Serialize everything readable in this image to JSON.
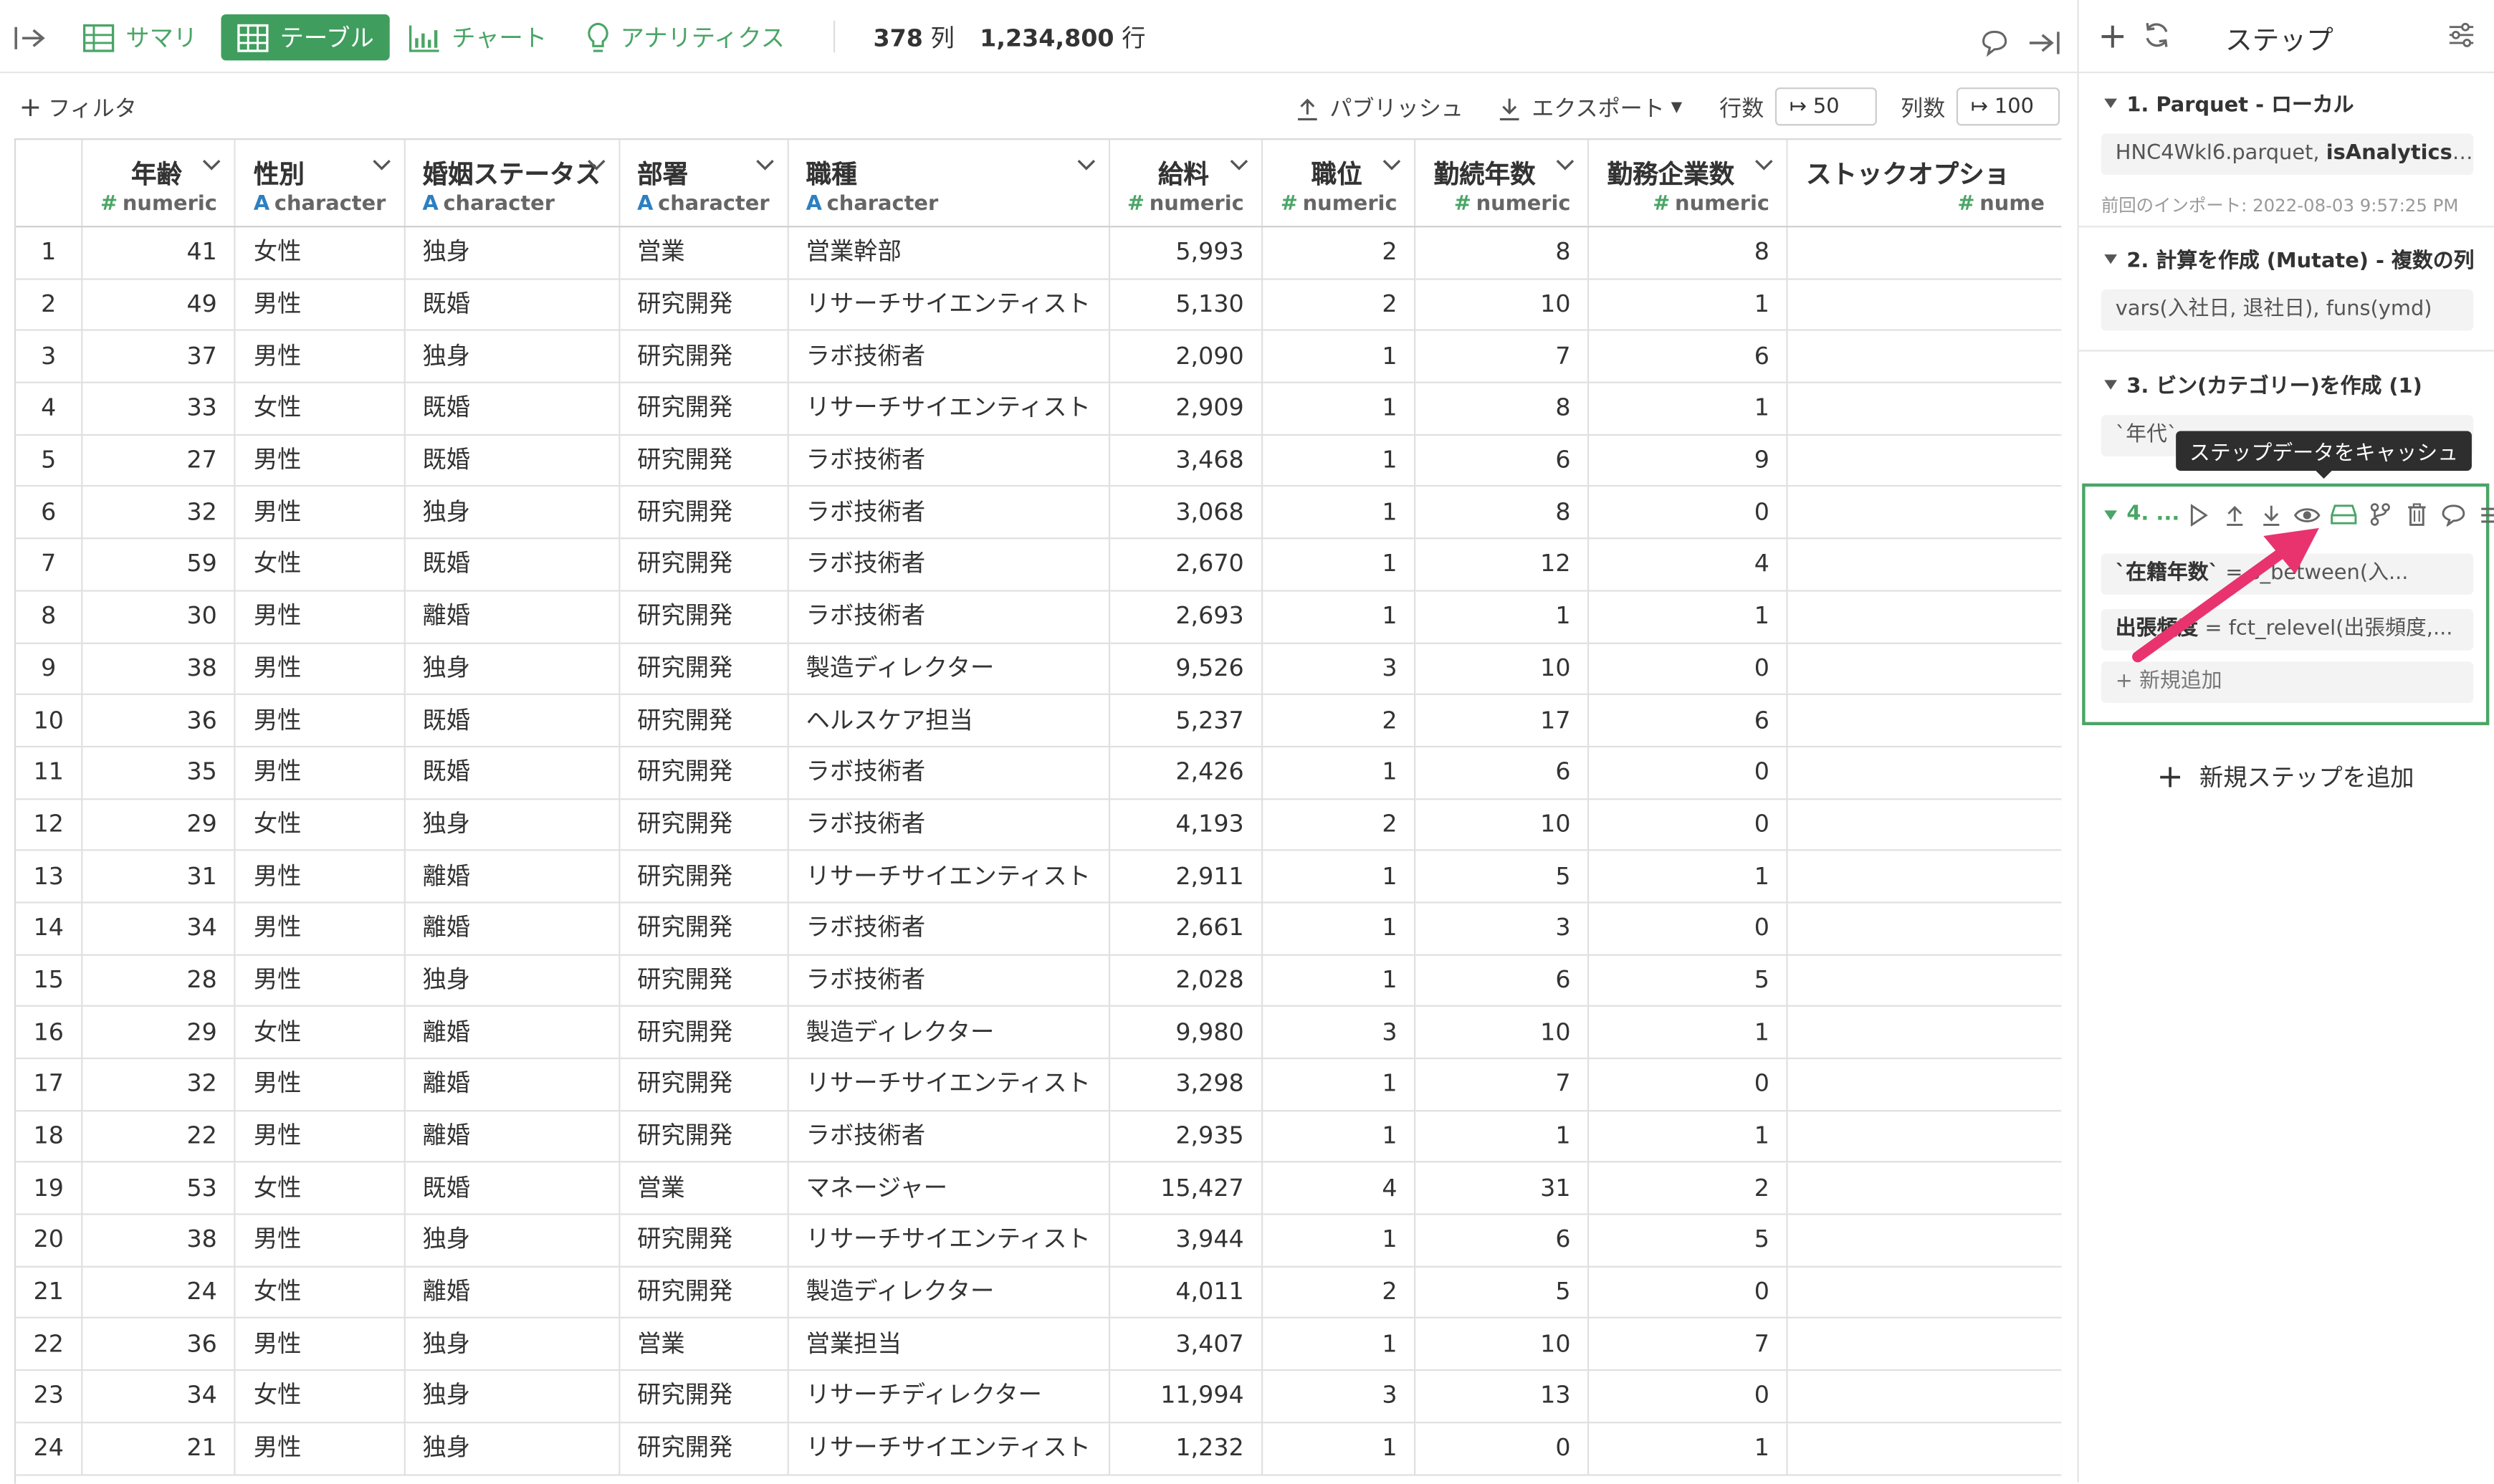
{
  "topbar": {
    "tabs": [
      {
        "label": "サマリ",
        "icon": "table-grid-icon"
      },
      {
        "label": "テーブル",
        "icon": "table-grid-icon"
      },
      {
        "label": "チャート",
        "icon": "bar-chart-icon"
      },
      {
        "label": "アナリティクス",
        "icon": "lightbulb-icon"
      }
    ],
    "col_count": "378",
    "col_unit": "列",
    "row_count": "1,234,800",
    "row_unit": "行"
  },
  "toolbar": {
    "filter_label": "フィルタ",
    "publish_label": "パブリッシュ",
    "export_label": "エクスポート",
    "rows_label": "行数",
    "rows_value": "50",
    "cols_label": "列数",
    "cols_value": "100"
  },
  "table": {
    "columns": [
      {
        "name": "年齢",
        "type": "numeric",
        "kind": "num"
      },
      {
        "name": "性別",
        "type": "character",
        "kind": "chr"
      },
      {
        "name": "婚姻ステータス",
        "type": "character",
        "kind": "chr"
      },
      {
        "name": "部署",
        "type": "character",
        "kind": "chr"
      },
      {
        "name": "職種",
        "type": "character",
        "kind": "chr"
      },
      {
        "name": "給料",
        "type": "numeric",
        "kind": "num"
      },
      {
        "name": "職位",
        "type": "numeric",
        "kind": "num"
      },
      {
        "name": "勤続年数",
        "type": "numeric",
        "kind": "num"
      },
      {
        "name": "勤務企業数",
        "type": "numeric",
        "kind": "num"
      },
      {
        "name": "ストックオプショ",
        "type": "nume",
        "kind": "num"
      }
    ],
    "rows": [
      [
        "1",
        "41",
        "女性",
        "独身",
        "営業",
        "営業幹部",
        "5,993",
        "2",
        "8",
        "8"
      ],
      [
        "2",
        "49",
        "男性",
        "既婚",
        "研究開発",
        "リサーチサイエンティスト",
        "5,130",
        "2",
        "10",
        "1"
      ],
      [
        "3",
        "37",
        "男性",
        "独身",
        "研究開発",
        "ラボ技術者",
        "2,090",
        "1",
        "7",
        "6"
      ],
      [
        "4",
        "33",
        "女性",
        "既婚",
        "研究開発",
        "リサーチサイエンティスト",
        "2,909",
        "1",
        "8",
        "1"
      ],
      [
        "5",
        "27",
        "男性",
        "既婚",
        "研究開発",
        "ラボ技術者",
        "3,468",
        "1",
        "6",
        "9"
      ],
      [
        "6",
        "32",
        "男性",
        "独身",
        "研究開発",
        "ラボ技術者",
        "3,068",
        "1",
        "8",
        "0"
      ],
      [
        "7",
        "59",
        "女性",
        "既婚",
        "研究開発",
        "ラボ技術者",
        "2,670",
        "1",
        "12",
        "4"
      ],
      [
        "8",
        "30",
        "男性",
        "離婚",
        "研究開発",
        "ラボ技術者",
        "2,693",
        "1",
        "1",
        "1"
      ],
      [
        "9",
        "38",
        "男性",
        "独身",
        "研究開発",
        "製造ディレクター",
        "9,526",
        "3",
        "10",
        "0"
      ],
      [
        "10",
        "36",
        "男性",
        "既婚",
        "研究開発",
        "ヘルスケア担当",
        "5,237",
        "2",
        "17",
        "6"
      ],
      [
        "11",
        "35",
        "男性",
        "既婚",
        "研究開発",
        "ラボ技術者",
        "2,426",
        "1",
        "6",
        "0"
      ],
      [
        "12",
        "29",
        "女性",
        "独身",
        "研究開発",
        "ラボ技術者",
        "4,193",
        "2",
        "10",
        "0"
      ],
      [
        "13",
        "31",
        "男性",
        "離婚",
        "研究開発",
        "リサーチサイエンティスト",
        "2,911",
        "1",
        "5",
        "1"
      ],
      [
        "14",
        "34",
        "男性",
        "離婚",
        "研究開発",
        "ラボ技術者",
        "2,661",
        "1",
        "3",
        "0"
      ],
      [
        "15",
        "28",
        "男性",
        "独身",
        "研究開発",
        "ラボ技術者",
        "2,028",
        "1",
        "6",
        "5"
      ],
      [
        "16",
        "29",
        "女性",
        "離婚",
        "研究開発",
        "製造ディレクター",
        "9,980",
        "3",
        "10",
        "1"
      ],
      [
        "17",
        "32",
        "男性",
        "離婚",
        "研究開発",
        "リサーチサイエンティスト",
        "3,298",
        "1",
        "7",
        "0"
      ],
      [
        "18",
        "22",
        "男性",
        "離婚",
        "研究開発",
        "ラボ技術者",
        "2,935",
        "1",
        "1",
        "1"
      ],
      [
        "19",
        "53",
        "女性",
        "既婚",
        "営業",
        "マネージャー",
        "15,427",
        "4",
        "31",
        "2"
      ],
      [
        "20",
        "38",
        "男性",
        "独身",
        "研究開発",
        "リサーチサイエンティスト",
        "3,944",
        "1",
        "6",
        "5"
      ],
      [
        "21",
        "24",
        "女性",
        "離婚",
        "研究開発",
        "製造ディレクター",
        "4,011",
        "2",
        "5",
        "0"
      ],
      [
        "22",
        "36",
        "男性",
        "独身",
        "営業",
        "営業担当",
        "3,407",
        "1",
        "10",
        "7"
      ],
      [
        "23",
        "34",
        "女性",
        "独身",
        "研究開発",
        "リサーチディレクター",
        "11,994",
        "3",
        "13",
        "0"
      ],
      [
        "24",
        "21",
        "男性",
        "独身",
        "研究開発",
        "リサーチサイエンティスト",
        "1,232",
        "1",
        "0",
        "1"
      ]
    ]
  },
  "panel": {
    "title": "ステップ",
    "steps": [
      {
        "title": "1. Parquet - ローカル",
        "chip_plain": "HNC4Wkl6.parquet, ",
        "chip_bold": "isAnalyticsRD...",
        "meta": "前回のインポート: 2022-08-03 9:57:25 PM"
      },
      {
        "title": "2. 計算を作成 (Mutate) - 複数の列",
        "chip_plain": "vars(入社日, 退社日), funs(ymd)"
      },
      {
        "title": "3. ビン(カテゴリー)を作成 (1)",
        "chip_plain": "`年代`"
      }
    ],
    "step4": {
      "title": "4. ...",
      "line1_bold": "`在籍年数`",
      "line1_rest": " = s_between(入...",
      "line2_bold": "出張頻度",
      "line2_rest": " = fct_relevel(出張頻度,...",
      "add_label": "+ 新規追加"
    },
    "tooltip": "ステップデータをキャッシュ",
    "add_step": "新規ステップを追加"
  },
  "colors": {
    "accent": "#4aa566",
    "active_tab": "#3f9e5e",
    "arrow": "#e8336f"
  }
}
